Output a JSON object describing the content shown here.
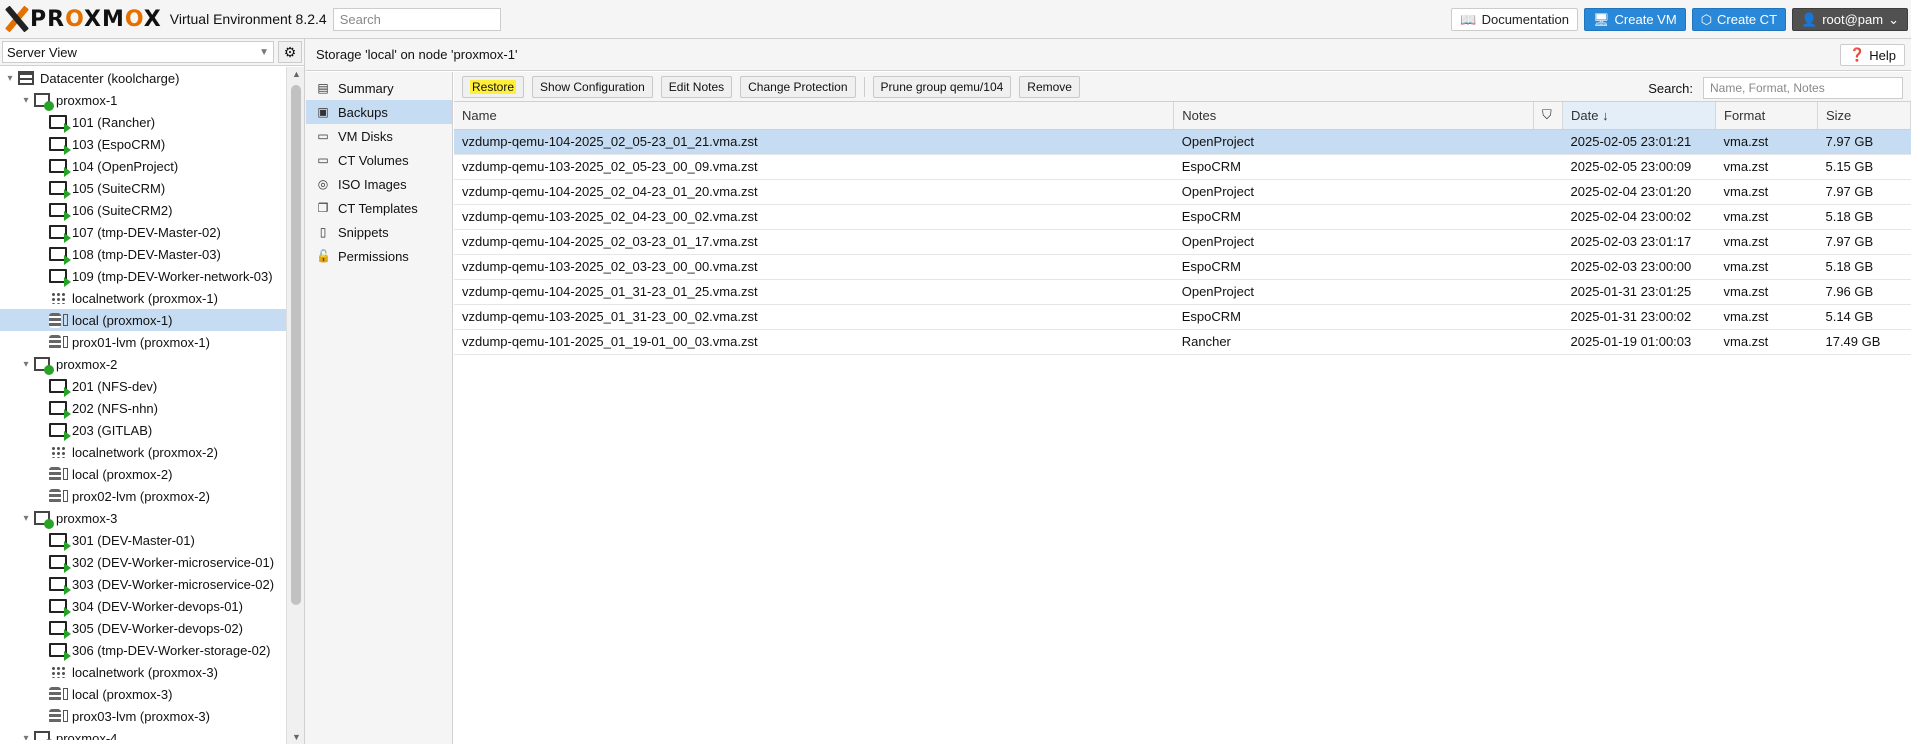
{
  "topbar": {
    "logo": "PROXMOX",
    "version": "Virtual Environment 8.2.4",
    "search_placeholder": "Search",
    "documentation": "Documentation",
    "create_vm": "Create VM",
    "create_ct": "Create CT",
    "user": "root@pam"
  },
  "sidebar": {
    "view": "Server View",
    "items": [
      {
        "label": "Datacenter (koolcharge)",
        "type": "datacenter",
        "level": 0
      },
      {
        "label": "proxmox-1",
        "type": "node",
        "level": 1
      },
      {
        "label": "101 (Rancher)",
        "type": "vm",
        "level": 2
      },
      {
        "label": "103 (EspoCRM)",
        "type": "vm",
        "level": 2
      },
      {
        "label": "104 (OpenProject)",
        "type": "vm",
        "level": 2
      },
      {
        "label": "105 (SuiteCRM)",
        "type": "vm",
        "level": 2
      },
      {
        "label": "106 (SuiteCRM2)",
        "type": "vm",
        "level": 2
      },
      {
        "label": "107 (tmp-DEV-Master-02)",
        "type": "vm",
        "level": 2
      },
      {
        "label": "108 (tmp-DEV-Master-03)",
        "type": "vm",
        "level": 2
      },
      {
        "label": "109 (tmp-DEV-Worker-network-03)",
        "type": "vm",
        "level": 2
      },
      {
        "label": "localnetwork (proxmox-1)",
        "type": "net",
        "level": 2
      },
      {
        "label": "local (proxmox-1)",
        "type": "storage",
        "level": 2,
        "selected": true
      },
      {
        "label": "prox01-lvm (proxmox-1)",
        "type": "storage",
        "level": 2
      },
      {
        "label": "proxmox-2",
        "type": "node",
        "level": 1
      },
      {
        "label": "201 (NFS-dev)",
        "type": "vm",
        "level": 2
      },
      {
        "label": "202 (NFS-nhn)",
        "type": "vm",
        "level": 2
      },
      {
        "label": "203 (GITLAB)",
        "type": "vm",
        "level": 2
      },
      {
        "label": "localnetwork (proxmox-2)",
        "type": "net",
        "level": 2
      },
      {
        "label": "local (proxmox-2)",
        "type": "storage",
        "level": 2
      },
      {
        "label": "prox02-lvm (proxmox-2)",
        "type": "storage",
        "level": 2
      },
      {
        "label": "proxmox-3",
        "type": "node",
        "level": 1
      },
      {
        "label": "301 (DEV-Master-01)",
        "type": "vm",
        "level": 2
      },
      {
        "label": "302 (DEV-Worker-microservice-01)",
        "type": "vm",
        "level": 2
      },
      {
        "label": "303 (DEV-Worker-microservice-02)",
        "type": "vm",
        "level": 2
      },
      {
        "label": "304 (DEV-Worker-devops-01)",
        "type": "vm",
        "level": 2
      },
      {
        "label": "305 (DEV-Worker-devops-02)",
        "type": "vm",
        "level": 2
      },
      {
        "label": "306 (tmp-DEV-Worker-storage-02)",
        "type": "vm",
        "level": 2
      },
      {
        "label": "localnetwork (proxmox-3)",
        "type": "net",
        "level": 2
      },
      {
        "label": "local (proxmox-3)",
        "type": "storage",
        "level": 2
      },
      {
        "label": "prox03-lvm (proxmox-3)",
        "type": "storage",
        "level": 2
      },
      {
        "label": "proxmox-4",
        "type": "node",
        "level": 1
      }
    ]
  },
  "main": {
    "title": "Storage 'local' on node 'proxmox-1'",
    "help": "Help",
    "nav": [
      {
        "label": "Summary",
        "icon": "book-icon"
      },
      {
        "label": "Backups",
        "icon": "floppy-icon",
        "active": true
      },
      {
        "label": "VM Disks",
        "icon": "hdd-icon"
      },
      {
        "label": "CT Volumes",
        "icon": "hdd-icon"
      },
      {
        "label": "ISO Images",
        "icon": "disc-icon"
      },
      {
        "label": "CT Templates",
        "icon": "copy-icon"
      },
      {
        "label": "Snippets",
        "icon": "file-icon"
      },
      {
        "label": "Permissions",
        "icon": "unlock-icon"
      }
    ],
    "toolbar": {
      "restore": "Restore",
      "show_config": "Show Configuration",
      "edit_notes": "Edit Notes",
      "change_protection": "Change Protection",
      "prune": "Prune group qemu/104",
      "remove": "Remove",
      "search_label": "Search:",
      "search_placeholder": "Name, Format, Notes"
    },
    "columns": [
      "Name",
      "Notes",
      "",
      "Date",
      "Format",
      "Size"
    ],
    "rows": [
      {
        "name": "vzdump-qemu-104-2025_02_05-23_01_21.vma.zst",
        "notes": "OpenProject",
        "date": "2025-02-05 23:01:21",
        "format": "vma.zst",
        "size": "7.97 GB",
        "selected": true
      },
      {
        "name": "vzdump-qemu-103-2025_02_05-23_00_09.vma.zst",
        "notes": "EspoCRM",
        "date": "2025-02-05 23:00:09",
        "format": "vma.zst",
        "size": "5.15 GB"
      },
      {
        "name": "vzdump-qemu-104-2025_02_04-23_01_20.vma.zst",
        "notes": "OpenProject",
        "date": "2025-02-04 23:01:20",
        "format": "vma.zst",
        "size": "7.97 GB"
      },
      {
        "name": "vzdump-qemu-103-2025_02_04-23_00_02.vma.zst",
        "notes": "EspoCRM",
        "date": "2025-02-04 23:00:02",
        "format": "vma.zst",
        "size": "5.18 GB"
      },
      {
        "name": "vzdump-qemu-104-2025_02_03-23_01_17.vma.zst",
        "notes": "OpenProject",
        "date": "2025-02-03 23:01:17",
        "format": "vma.zst",
        "size": "7.97 GB"
      },
      {
        "name": "vzdump-qemu-103-2025_02_03-23_00_00.vma.zst",
        "notes": "EspoCRM",
        "date": "2025-02-03 23:00:00",
        "format": "vma.zst",
        "size": "5.18 GB"
      },
      {
        "name": "vzdump-qemu-104-2025_01_31-23_01_25.vma.zst",
        "notes": "OpenProject",
        "date": "2025-01-31 23:01:25",
        "format": "vma.zst",
        "size": "7.96 GB"
      },
      {
        "name": "vzdump-qemu-103-2025_01_31-23_00_02.vma.zst",
        "notes": "EspoCRM",
        "date": "2025-01-31 23:00:02",
        "format": "vma.zst",
        "size": "5.14 GB"
      },
      {
        "name": "vzdump-qemu-101-2025_01_19-01_00_03.vma.zst",
        "notes": "Rancher",
        "date": "2025-01-19 01:00:03",
        "format": "vma.zst",
        "size": "17.49 GB"
      }
    ]
  }
}
